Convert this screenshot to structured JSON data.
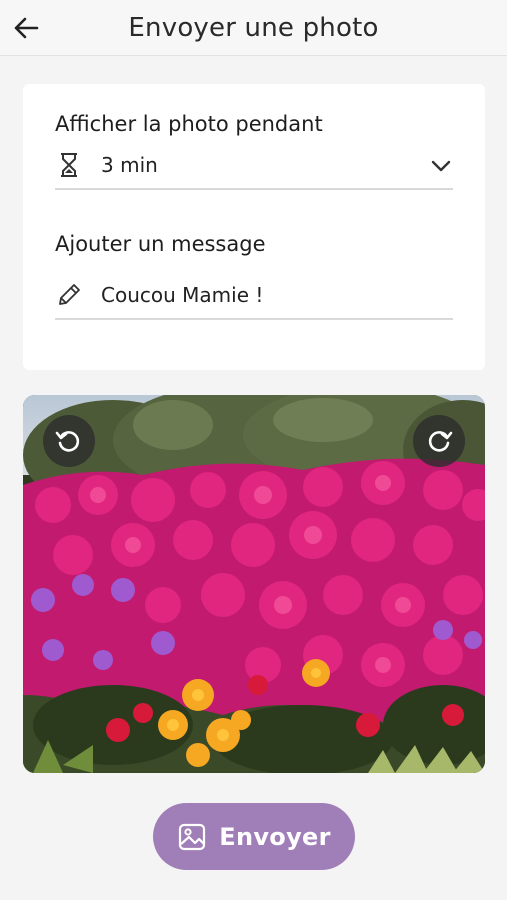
{
  "header": {
    "title": "Envoyer une photo",
    "back_icon": "arrow-left-icon"
  },
  "form": {
    "duration": {
      "label": "Afficher la photo pendant",
      "value": "3 min",
      "icon": "hourglass-icon",
      "dropdown_icon": "chevron-down-icon"
    },
    "message": {
      "label": "Ajouter un message",
      "value": "Coucou Mamie !",
      "icon": "pencil-icon"
    }
  },
  "photo": {
    "description_icon": "flower-photo",
    "rotate_left_icon": "rotate-left-icon",
    "rotate_right_icon": "rotate-right-icon"
  },
  "send_button": {
    "label": "Envoyer",
    "icon": "image-icon",
    "color": "#a07fb8"
  }
}
